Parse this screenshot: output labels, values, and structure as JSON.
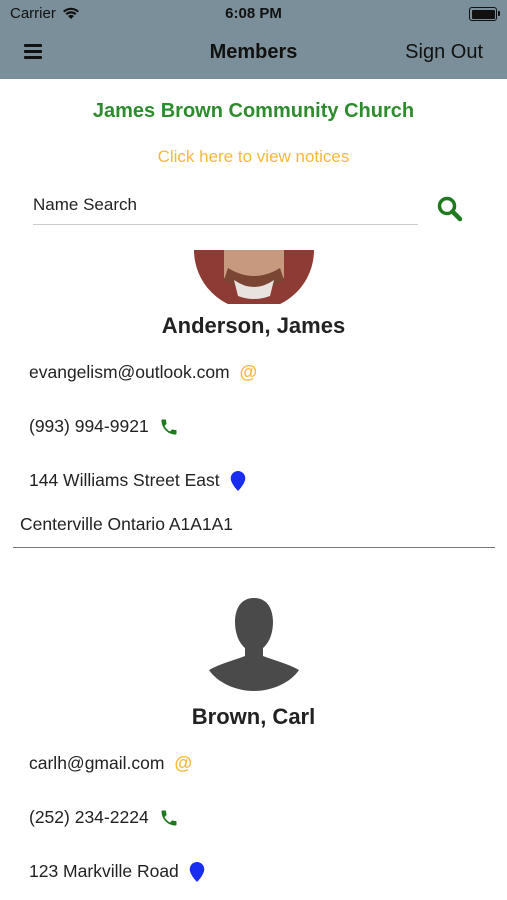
{
  "status_bar": {
    "carrier": "Carrier",
    "time": "6:08 PM",
    "battery_level": 1.0
  },
  "nav": {
    "title": "Members",
    "sign_out_label": "Sign Out",
    "menu_icon": "hamburger-icon"
  },
  "header": {
    "church_name": "James Brown Community Church",
    "notices_link": "Click here to view notices"
  },
  "search": {
    "placeholder": "Name Search",
    "value": ""
  },
  "colors": {
    "nav_bg": "#7a8f99",
    "church_green": "#2e8b2e",
    "accent_yellow": "#f4b93b",
    "phone_green": "#1f7a1f",
    "pin_blue": "#1a2ef2"
  },
  "members": [
    {
      "name": "Anderson, James",
      "email": "evangelism@outlook.com",
      "phone": "(993) 994-9921",
      "address_line1": "144 Williams Street East",
      "address_line2": "Centerville Ontario A1A1A1"
    },
    {
      "name": "Brown, Carl",
      "email": "carlh@gmail.com",
      "phone": "(252) 234-2224",
      "address_line1": "123 Markville Road"
    }
  ]
}
